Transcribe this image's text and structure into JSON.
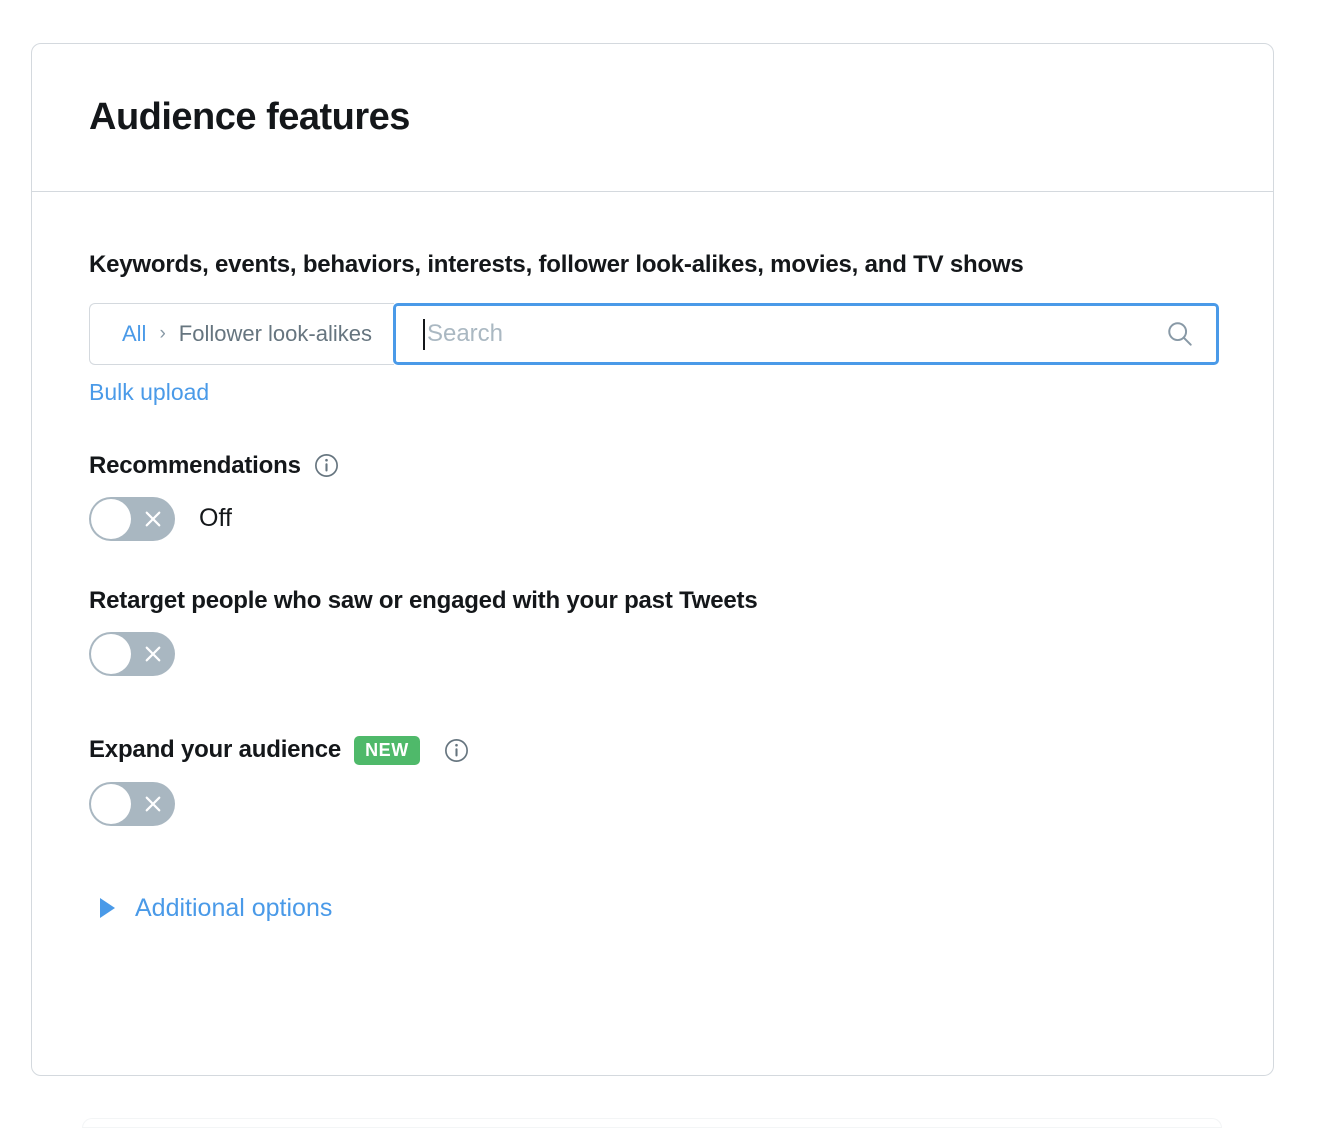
{
  "card": {
    "title": "Audience features",
    "field_heading": "Keywords, events, behaviors, interests, follower look-alikes, movies, and TV shows",
    "search": {
      "breadcrumb_root": "All",
      "breadcrumb_separator": "›",
      "breadcrumb_current": "Follower look-alikes",
      "placeholder": "Search",
      "value": "",
      "focused": true,
      "icon": "search-icon"
    },
    "bulk_upload_label": "Bulk upload",
    "recommendations": {
      "label": "Recommendations",
      "info_icon": "info-icon",
      "toggle_state": "off",
      "toggle_state_label": "Off"
    },
    "retarget": {
      "label": "Retarget people who saw or engaged with your past Tweets",
      "toggle_state": "off"
    },
    "expand_audience": {
      "label": "Expand your audience",
      "badge": "NEW",
      "info_icon": "info-icon",
      "toggle_state": "off"
    },
    "additional_options": {
      "label": "Additional options",
      "expanded": false,
      "icon": "triangle-right-icon"
    }
  },
  "colors": {
    "accent_blue": "#4a9ae8",
    "text_primary": "#14171a",
    "text_secondary": "#66757f",
    "placeholder": "#aab8c2",
    "border": "#d4d9de",
    "toggle_off_track": "#a9b7c1",
    "badge_green": "#4fb96a"
  }
}
